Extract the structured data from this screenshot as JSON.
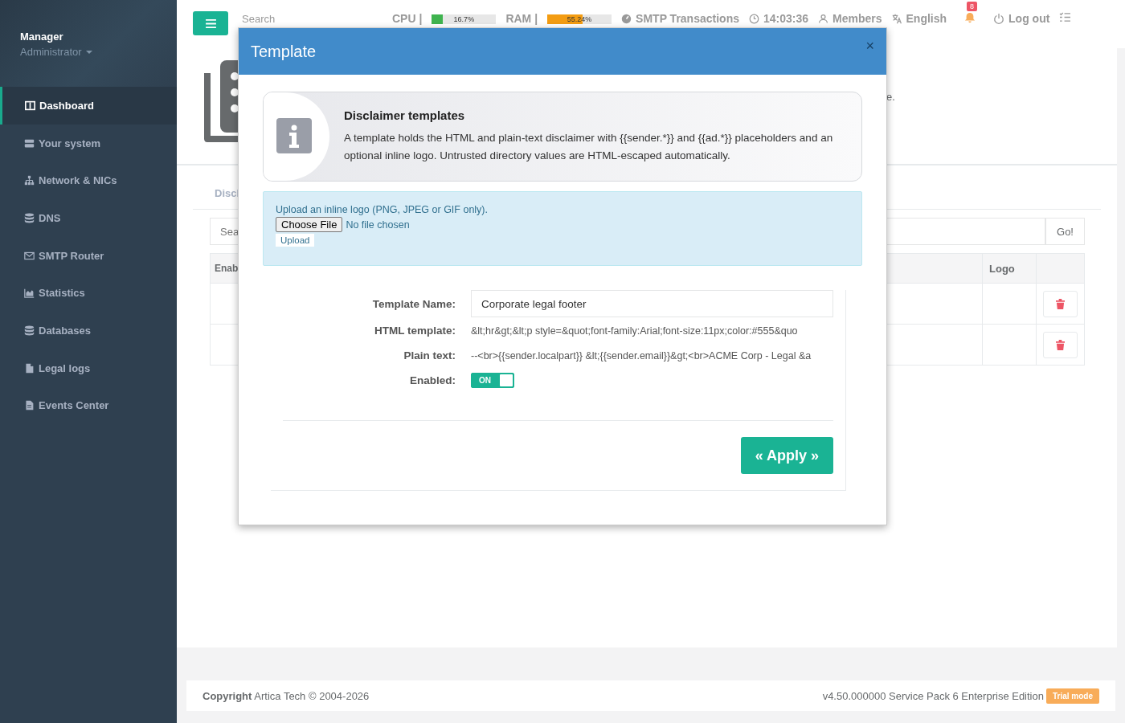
{
  "sidebar": {
    "user": "Manager",
    "role": "Administrator",
    "items": [
      {
        "label": "Dashboard",
        "selected": true
      },
      {
        "label": "Your system",
        "selected": false
      },
      {
        "label": "Network & NICs",
        "selected": false
      },
      {
        "label": "DNS",
        "selected": false
      },
      {
        "label": "SMTP Router",
        "selected": false
      },
      {
        "label": "Statistics",
        "selected": false
      },
      {
        "label": "Databases",
        "selected": false
      },
      {
        "label": "Legal logs",
        "selected": false
      },
      {
        "label": "Events Center",
        "selected": false
      }
    ]
  },
  "topbar": {
    "search": {
      "placeholder": "Search"
    },
    "meters": [
      {
        "label": "CPU |",
        "level": 0.167,
        "reading": "16.7%",
        "color": "#3fb34f"
      },
      {
        "label": "RAM |",
        "level": 0.5524,
        "reading": "55.24%",
        "color": "#f39c12"
      }
    ],
    "links": [
      {
        "label": "SMTP Transactions"
      },
      {
        "label": "14:03:36"
      },
      {
        "label": "Members"
      },
      {
        "label": "English"
      }
    ],
    "notifications": "8",
    "logout": "Log out"
  },
  "page": {
    "header_text": "e.",
    "tab": "Discl",
    "search": {
      "placeholder": "Sea"
    },
    "go": "Go!",
    "table": {
      "columns": [
        "Enab",
        "Logo"
      ],
      "rows": [
        {
          "kind": "deletable"
        },
        {
          "kind": "deletable"
        }
      ]
    }
  },
  "modal": {
    "title": "Template",
    "close": "×",
    "callout": {
      "title": "Disclaimer templates",
      "text": "A template holds the HTML and plain-text disclaimer with {{sender.*}} and {{ad.*}} placeholders and an optional inline logo. Untrusted directory values are HTML-escaped automatically."
    },
    "upload": {
      "text": "Upload an inline logo (PNG, JPEG or GIF only).",
      "choose": "Choose File",
      "no_file": "No file chosen",
      "button": "Upload"
    },
    "fields": [
      {
        "kind": "input",
        "label": "Template Name:",
        "value": "Corporate legal footer"
      },
      {
        "kind": "text",
        "label": "HTML template:",
        "value": "&lt;hr&gt;&lt;p style=&quot;font-family:Arial;font-size:11px;color:#555&quo"
      },
      {
        "kind": "text",
        "label": "Plain text:",
        "value": "--<br>{{sender.localpart}} &lt;{{sender.email}}&gt;<br>ACME Corp - Legal &a"
      },
      {
        "kind": "toggle",
        "label": "Enabled:",
        "on": true,
        "value": "ON"
      }
    ],
    "apply": "« Apply »"
  },
  "footer": {
    "copyright": "**Copyright** Artica Tech © 2004-2026",
    "version": "v4.50.000000 Service Pack 6 Enterprise Edition",
    "badge": "Trial mode"
  }
}
